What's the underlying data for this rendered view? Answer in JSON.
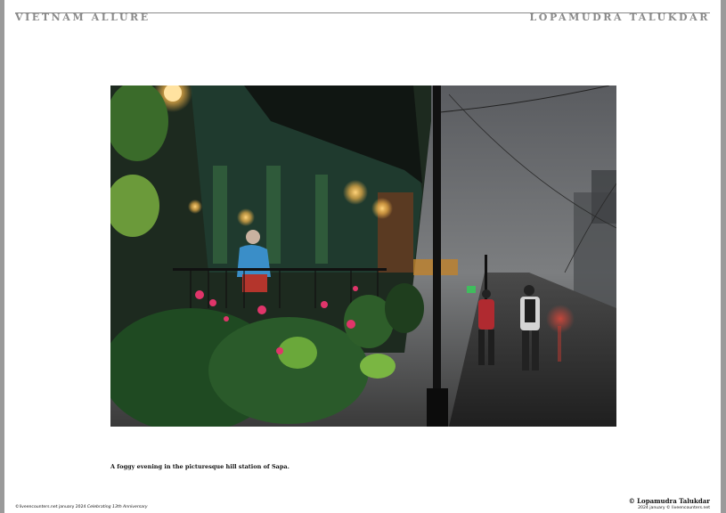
{
  "header": {
    "left_title": "VIETNAM ALLURE",
    "right_title": "LOPAMUDRA TALUKDAR"
  },
  "photo": {
    "caption": "A foggy evening in the picturesque hill station of Sapa."
  },
  "footer": {
    "left_text": "©liveencounters.net january 2024",
    "left_italic": "Celebrating 13th Anniversary",
    "right_name": "© Lopamudra Talukdar",
    "right_sub": "2024 january © liveencounters.net"
  },
  "colors": {
    "header_text": "#8a8a8a",
    "lamp_glow": "#f4b54a",
    "fog": "#7c7e80"
  }
}
